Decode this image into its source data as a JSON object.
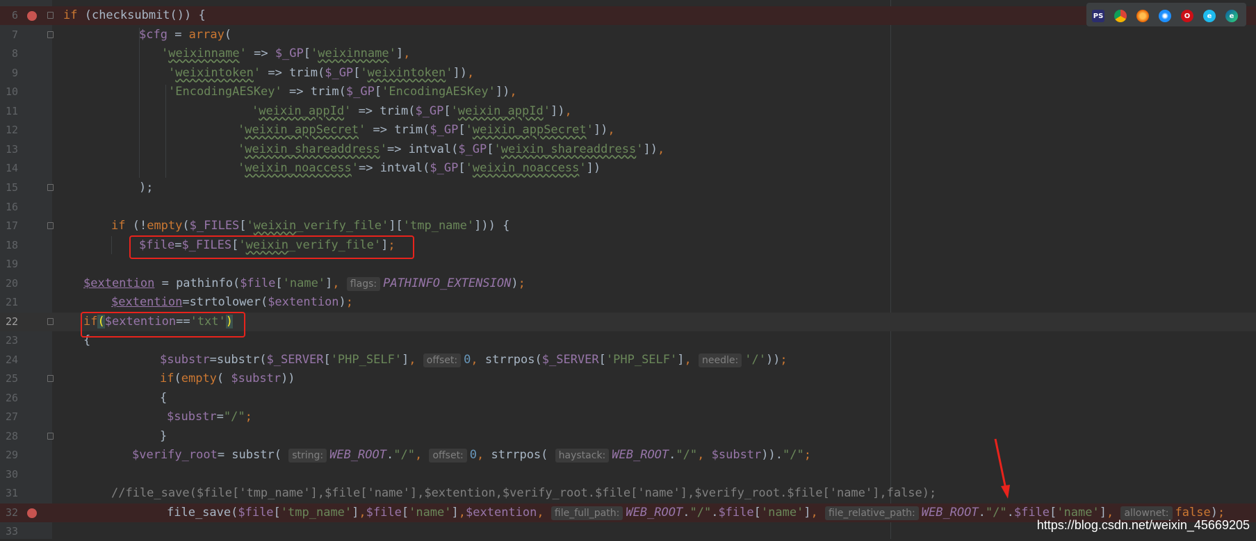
{
  "browser_icons": [
    "phpstorm-icon",
    "chrome-icon",
    "firefox-icon",
    "safari-icon",
    "opera-icon",
    "ie-icon",
    "edge-icon"
  ],
  "watermark": "https://blog.csdn.net/weixin_45669205",
  "lines": {
    "l6": "6",
    "l7": "7",
    "l8": "8",
    "l9": "9",
    "l10": "10",
    "l11": "11",
    "l12": "12",
    "l13": "13",
    "l14": "14",
    "l15": "15",
    "l16": "16",
    "l17": "17",
    "l18": "18",
    "l19": "19",
    "l20": "20",
    "l21": "21",
    "l22": "22",
    "l23": "23",
    "l24": "24",
    "l25": "25",
    "l26": "26",
    "l27": "27",
    "l28": "28",
    "l29": "29",
    "l30": "30",
    "l31": "31",
    "l32": "32",
    "l33": "33"
  },
  "code": {
    "c6": "if (checksubmit()) {",
    "c15": ");",
    "c26": "{",
    "c27": "$substr=\"/\";",
    "c28": "}",
    "c31": "//file_save($file['tmp_name'],$file['name'],$extention,$verify_root.$file['name'],$verify_root.$file['name'],false);"
  },
  "hints": {
    "flags": "flags:",
    "offset": "offset:",
    "needle": "needle:",
    "string": "string:",
    "haystack": "haystack:",
    "file_full_path": "file_full_path:",
    "file_relative_path": "file_relative_path:",
    "allownet": "allownet:"
  },
  "colors": {
    "background": "#2b2b2b",
    "gutter": "#313335",
    "keyword": "#cc7832",
    "variable": "#9876aa",
    "string": "#6a8759",
    "number": "#6897bb",
    "breakpoint": "#c75450",
    "annotation_box": "#e8231c"
  }
}
